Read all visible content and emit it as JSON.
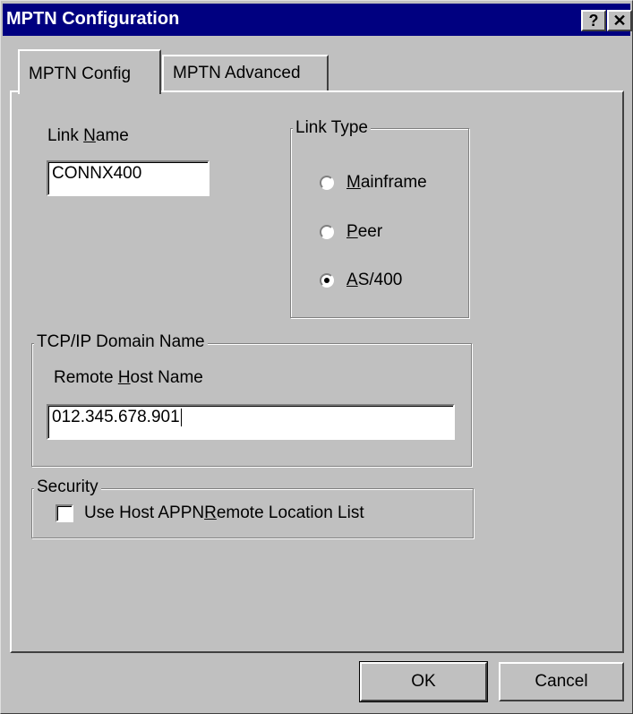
{
  "window": {
    "title": "MPTN Configuration",
    "help_glyph": "?",
    "close_glyph": "✕"
  },
  "tabs": [
    {
      "label": "MPTN Config",
      "active": true
    },
    {
      "label": "MPTN Advanced",
      "active": false
    }
  ],
  "link_name": {
    "label_pre": "Link ",
    "label_key": "N",
    "label_post": "ame",
    "value": "CONNX400"
  },
  "link_type": {
    "legend": "Link Type",
    "options": [
      {
        "key": "M",
        "rest": "ainframe",
        "checked": false
      },
      {
        "key": "P",
        "rest": "eer",
        "checked": false
      },
      {
        "key": "A",
        "rest": "S/400",
        "checked": true
      }
    ]
  },
  "tcpip": {
    "legend": "TCP/IP Domain Name",
    "label_pre": "Remote ",
    "label_key": "H",
    "label_post": "ost Name",
    "value": "012.345.678.901"
  },
  "security": {
    "legend": "Security",
    "checkbox_pre": "Use Host APPN ",
    "checkbox_key": "R",
    "checkbox_post": "emote Location List",
    "checked": false
  },
  "buttons": {
    "ok": "OK",
    "cancel": "Cancel"
  }
}
